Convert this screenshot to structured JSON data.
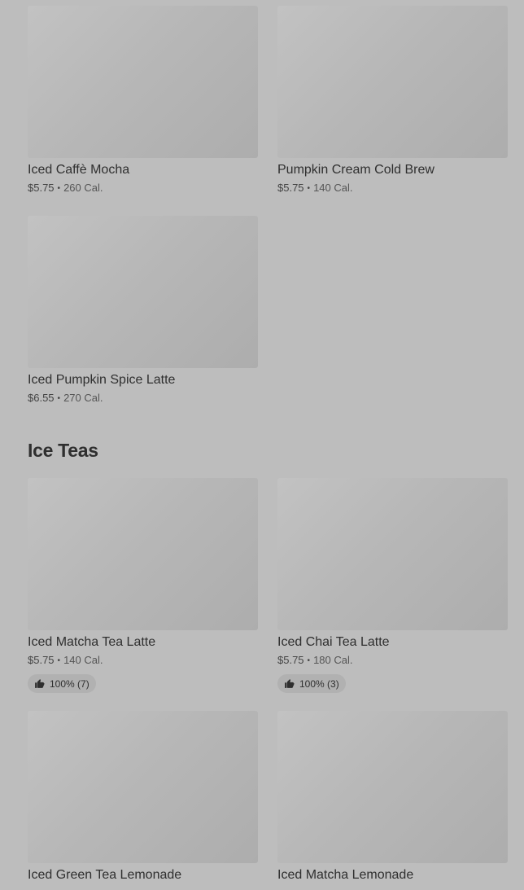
{
  "menu_top": [
    {
      "name": "Iced Caffè Mocha",
      "price": "$5.75",
      "separator": "•",
      "calories": "260 Cal."
    },
    {
      "name": "Pumpkin Cream Cold Brew",
      "price": "$5.75",
      "separator": "•",
      "calories": "140 Cal."
    },
    {
      "name": "Iced Pumpkin Spice Latte",
      "price": "$6.55",
      "separator": "•",
      "calories": "270 Cal."
    }
  ],
  "ice_teas": {
    "title": "Ice Teas",
    "items": [
      {
        "name": "Iced Matcha Tea Latte",
        "price": "$5.75",
        "separator": "•",
        "calories": "140 Cal.",
        "rating": "100% (7)",
        "rating_icon": "thumbs-up-icon"
      },
      {
        "name": "Iced Chai Tea Latte",
        "price": "$5.75",
        "separator": "•",
        "calories": "180 Cal.",
        "rating": "100% (3)",
        "rating_icon": "thumbs-up-icon"
      },
      {
        "name": "Iced Green Tea Lemonade",
        "price": "",
        "separator": "",
        "calories": ""
      },
      {
        "name": "Iced Matcha Lemonade",
        "price": "",
        "separator": "",
        "calories": ""
      }
    ]
  },
  "colors": {
    "background": "#bdbdbd",
    "thumbnail": "#b7b7b7",
    "text": "#2f2f2f",
    "rating_pill": "#b1b1b1"
  }
}
